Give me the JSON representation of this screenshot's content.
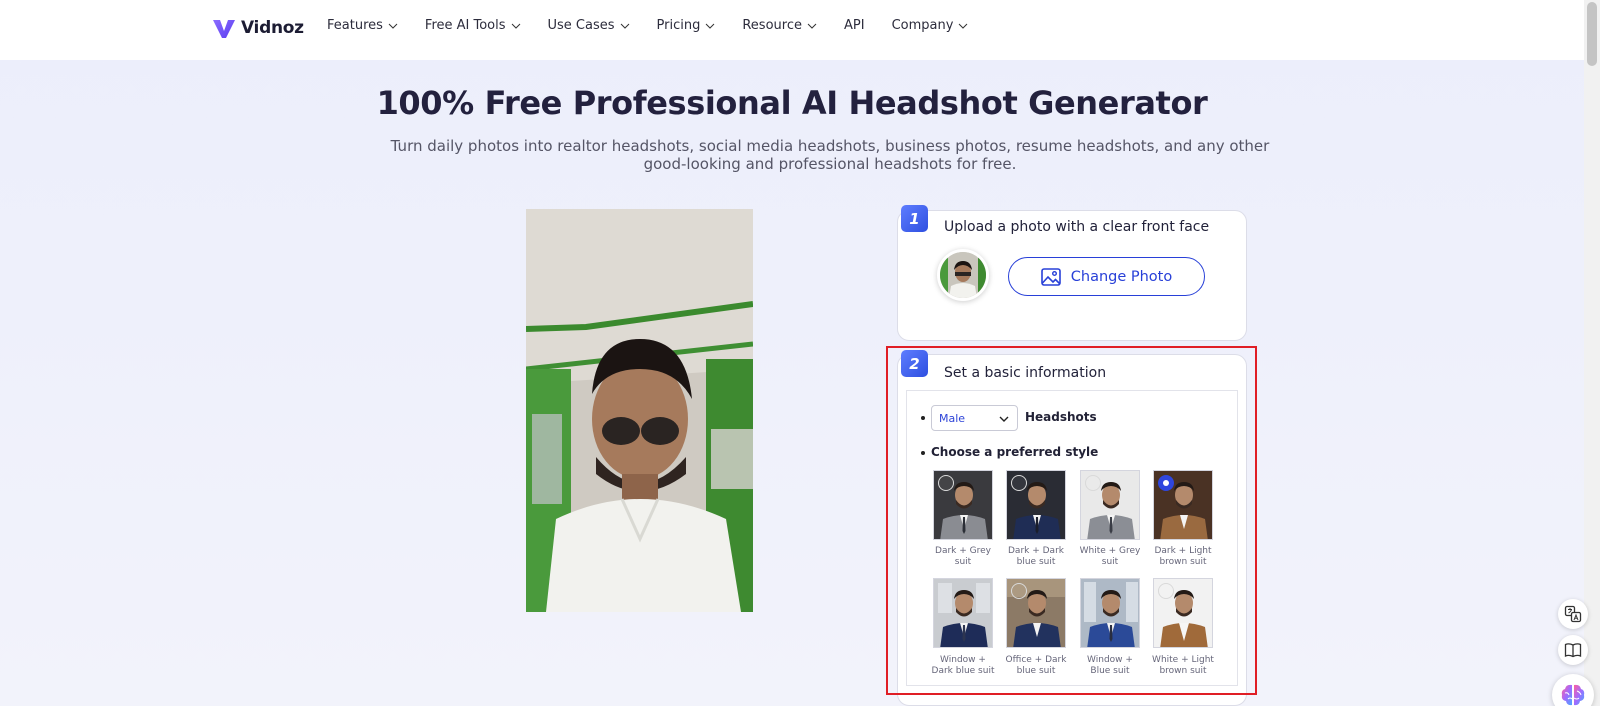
{
  "brand": {
    "name": "Vidnoz"
  },
  "nav": {
    "items": [
      {
        "label": "Features",
        "has_dropdown": true
      },
      {
        "label": "Free AI Tools",
        "has_dropdown": true
      },
      {
        "label": "Use Cases",
        "has_dropdown": true
      },
      {
        "label": "Pricing",
        "has_dropdown": true
      },
      {
        "label": "Resource",
        "has_dropdown": true
      },
      {
        "label": "API",
        "has_dropdown": false
      },
      {
        "label": "Company",
        "has_dropdown": true
      }
    ]
  },
  "hero": {
    "title": "100% Free Professional AI Headshot Generator",
    "subtitle_line1": "Turn daily photos into realtor headshots, social media headshots, business photos, resume headshots, and any other",
    "subtitle_line2": "good-looking and professional headshots for free."
  },
  "step1": {
    "number": "1",
    "title": "Upload a photo with a clear front face",
    "change_photo_label": "Change Photo"
  },
  "step2": {
    "number": "2",
    "title": "Set a basic information",
    "gender_select": {
      "value": "Male"
    },
    "headshots_label": "Headshots",
    "choose_style_label": "Choose a preferred style",
    "styles": [
      {
        "line1": "Dark + Grey",
        "line2": "suit",
        "selected": false,
        "bg": "#3a3a3e",
        "suit": "#8a8c92"
      },
      {
        "line1": "Dark + Dark",
        "line2": "blue suit",
        "selected": false,
        "bg": "#2a2c34",
        "suit": "#1f2d55"
      },
      {
        "line1": "White + Grey",
        "line2": "suit",
        "selected": false,
        "bg": "#e9e9e9",
        "suit": "#8b8e95"
      },
      {
        "line1": "Dark + Light",
        "line2": "brown suit",
        "selected": true,
        "bg": "#4a3224",
        "suit": "#9a6a40"
      },
      {
        "line1": "Window +",
        "line2": "Dark blue suit",
        "selected": false,
        "bg": "#c9ccd0",
        "suit": "#1e2c58"
      },
      {
        "line1": "Office + Dark",
        "line2": "blue suit",
        "selected": false,
        "bg": "#8c7a66",
        "suit": "#22325e"
      },
      {
        "line1": "Window +",
        "line2": "Blue suit",
        "selected": false,
        "bg": "#aeb9c6",
        "suit": "#2b4a98"
      },
      {
        "line1": "White + Light",
        "line2": "brown suit",
        "selected": false,
        "bg": "#f2f2f2",
        "suit": "#a06a3a"
      }
    ]
  },
  "colors": {
    "accent": "#2840d8",
    "highlight_border": "#e01e25",
    "title_text": "#23213e"
  },
  "icons": {
    "logo": "vidnoz-logo-icon",
    "change_photo": "image-icon",
    "translate": "translate-icon",
    "reader": "book-icon",
    "assistant": "brain-icon"
  }
}
